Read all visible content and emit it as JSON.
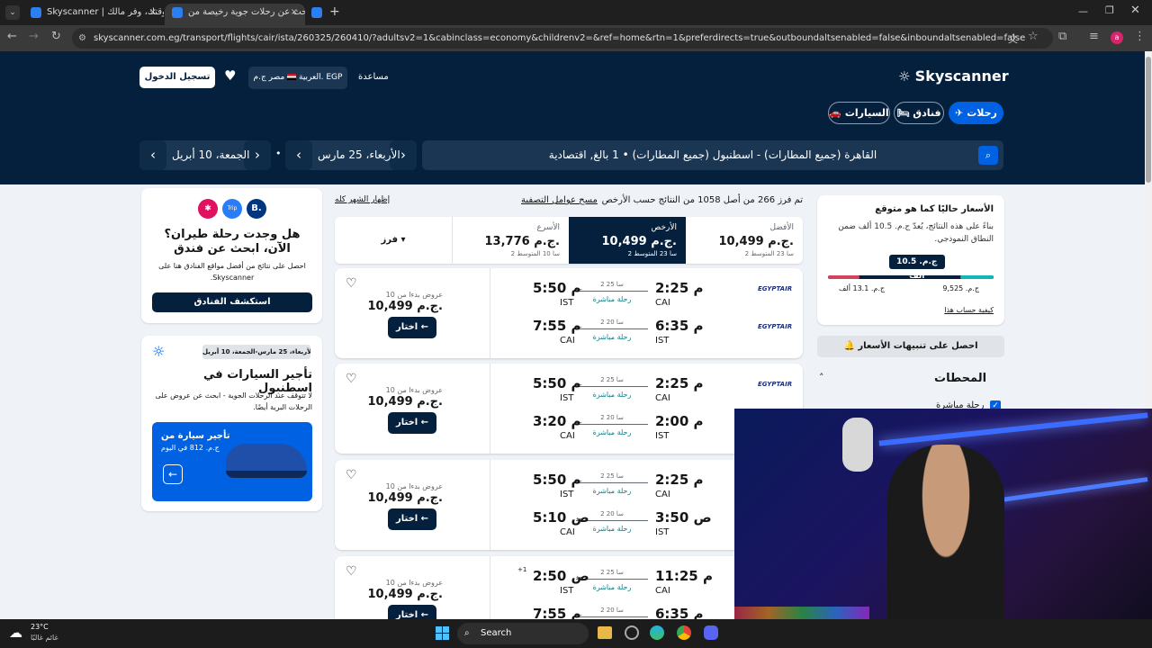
{
  "browser": {
    "tabs": [
      {
        "label": "Skyscanner | وفر وقتك، وفر مالك!"
      },
      {
        "label": "ابحث عن رحلات جوية رخيصة من"
      },
      {
        "label": ""
      }
    ],
    "new_tab": "+",
    "url": "skyscanner.com.eg/transport/flights/cair/ista/260325/260410/?adultsv2=1&cabinclass=economy&childrenv2=&ref=home&rtn=1&preferdirects=true&outboundaltsenabled=false&inboundaltsenabled=false",
    "avatar": "a"
  },
  "header": {
    "logo": "Skyscanner",
    "help": "مساعدة",
    "locale": "العربية",
    "country": "مصر",
    "currency": "ج.م. EGP",
    "login": "تسجيل الدخول",
    "tabs": [
      {
        "label": "رحلات"
      },
      {
        "label": "فنادق"
      },
      {
        "label": "السيارات"
      }
    ],
    "search_route": "القاهرة (جميع المطارات) - اسطنبول (جميع المطارات)",
    "search_pax": "1 بالغ, اقتصادية",
    "depart_date": "الأربعاء، 25 مارس",
    "return_date": "الجمعة، 10 أبريل"
  },
  "results": {
    "summary": "تم فرز 266 من أصل 1058 من النتائج حسب الأرخص",
    "clear_filters": "مسح عوامل التصفية",
    "show_month": "إظهار الشهر كله",
    "sort": [
      {
        "label": "الأفضل",
        "price": "10,499 ج.م.",
        "meta": "2 سا 23 المتوسط"
      },
      {
        "label": "الأرخص",
        "price": "10,499 ج.م.",
        "meta": "2 سا 23 المتوسط"
      },
      {
        "label": "الأسرع",
        "price": "13,776 ج.م.",
        "meta": "2 سا 10 المتوسط"
      }
    ],
    "sort_menu": "فرز",
    "deals_label": "10 عروض بدءا من",
    "select": "اختار",
    "flights": [
      {
        "price": "10,499 ج.م.",
        "out": {
          "dep": "2:25 م",
          "arr": "5:50 م",
          "from": "CAI",
          "to": "IST",
          "dur": "2 سا 25",
          "stops": "رحلة مباشرة"
        },
        "in": {
          "dep": "6:35 م",
          "arr": "7:55 م",
          "from": "IST",
          "to": "CAI",
          "dur": "2 سا 20",
          "stops": "رحلة مباشرة"
        }
      },
      {
        "price": "10,499 ج.م.",
        "out": {
          "dep": "2:25 م",
          "arr": "5:50 م",
          "from": "CAI",
          "to": "IST",
          "dur": "2 سا 25",
          "stops": "رحلة مباشرة"
        },
        "in": {
          "dep": "2:00 م",
          "arr": "3:20 م",
          "from": "IST",
          "to": "CAI",
          "dur": "2 سا 20",
          "stops": "رحلة مباشرة"
        }
      },
      {
        "price": "10,499 ج.م.",
        "out": {
          "dep": "2:25 م",
          "arr": "5:50 م",
          "from": "CAI",
          "to": "IST",
          "dur": "2 سا 25",
          "stops": "رحلة مباشرة"
        },
        "in": {
          "dep": "3:50 ص",
          "arr": "5:10 ص",
          "from": "IST",
          "to": "CAI",
          "dur": "2 سا 20",
          "stops": "رحلة مباشرة"
        }
      },
      {
        "price": "10,499 ج.م.",
        "out": {
          "dep": "11:25 م",
          "arr": "2:50 ص",
          "from": "CAI",
          "to": "IST",
          "dur": "2 سا 25",
          "stops": "رحلة مباشرة",
          "plus": "+1"
        },
        "in": {
          "dep": "6:35 م",
          "arr": "7:55 م",
          "from": "IST",
          "to": "CAI",
          "dur": "2 سا 20",
          "stops": "رحلة مباشرة"
        }
      }
    ]
  },
  "insight": {
    "title": "الأسعار حاليًا كما هو متوقع",
    "body": "بناءً على هذه النتائج، يُعدّ ج.م. 10.5 ألف ضمن النطاق النموذجي.",
    "marker": "ج.م. 10.5 ألف",
    "low": "ج.م. 9,525",
    "high": "ج.م. 13.1 ألف",
    "how": "كيفية حساب هذا",
    "alerts": "احصل على تنبيهات الأسعار",
    "marker_pos": 0.42
  },
  "filters": {
    "stops_title": "المحطات",
    "direct": "رحلة مباشرة"
  },
  "hotels_promo": {
    "title": "هل وجدت رحلة طيران؟ الآن، ابحث عن فندق",
    "body": "احصل على نتائج من أفضل مواقع الفنادق هنا على Skyscanner.",
    "cta": "استكشف الفنادق",
    "logos": [
      "B.",
      "Trip",
      ""
    ]
  },
  "cars_promo": {
    "dates": "الأربعاء، 25 مارس-الجمعة، 10 أبريل",
    "title": "تأجير السيارات في اسطنبول",
    "body": "لا تتوقف عند الرحلات الجوية - ابحث عن عروض على الرحلات البرية أيضًا.",
    "card_title": "تأجير سيارة من",
    "card_price": "ج.م. 812 في اليوم"
  },
  "taskbar": {
    "temp": "23°C",
    "weather": "غائم غالبًا",
    "search": "Search"
  },
  "colors": {
    "navy": "#05203c",
    "accent": "#0062e3",
    "teal": "#0c838a"
  }
}
